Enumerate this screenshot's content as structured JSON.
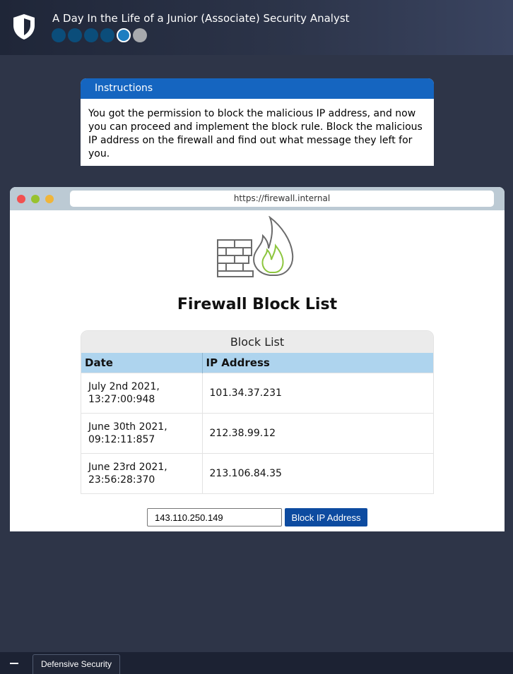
{
  "header": {
    "title": "A Day In the Life of a Junior (Associate) Security Analyst",
    "logo_icon": "shield-icon",
    "progress": {
      "total_steps": 6,
      "current_step": 5,
      "completed_steps": 4
    }
  },
  "instructions": {
    "heading": "Instructions",
    "body": "You got the permission to block the malicious IP address, and now you can proceed and implement the block rule. Block the malicious IP address on the firewall and find out what message they left for you."
  },
  "browser": {
    "url": "https://firewall.internal"
  },
  "firewall": {
    "logo_icon": "firewall-icon",
    "title": "Firewall Block List",
    "block_list": {
      "heading": "Block List",
      "columns": [
        "Date",
        "IP Address"
      ],
      "rows": [
        {
          "date": "July 2nd 2021, 13:27:00:948",
          "ip": "101.34.37.231"
        },
        {
          "date": "June 30th 2021, 09:12:11:857",
          "ip": "212.38.99.12"
        },
        {
          "date": "June 23rd 2021, 23:56:28:370",
          "ip": "213.106.84.35"
        }
      ]
    },
    "ip_input_value": "143.110.250.149",
    "block_button_label": "Block IP Address"
  },
  "taskbar": {
    "tab_label": "Defensive Security"
  },
  "colors": {
    "background": "#2e3548",
    "accent_blue": "#1565c0",
    "button_blue": "#0d4ba0",
    "table_header": "#aed4ee",
    "flame_green": "#8dc63f"
  }
}
